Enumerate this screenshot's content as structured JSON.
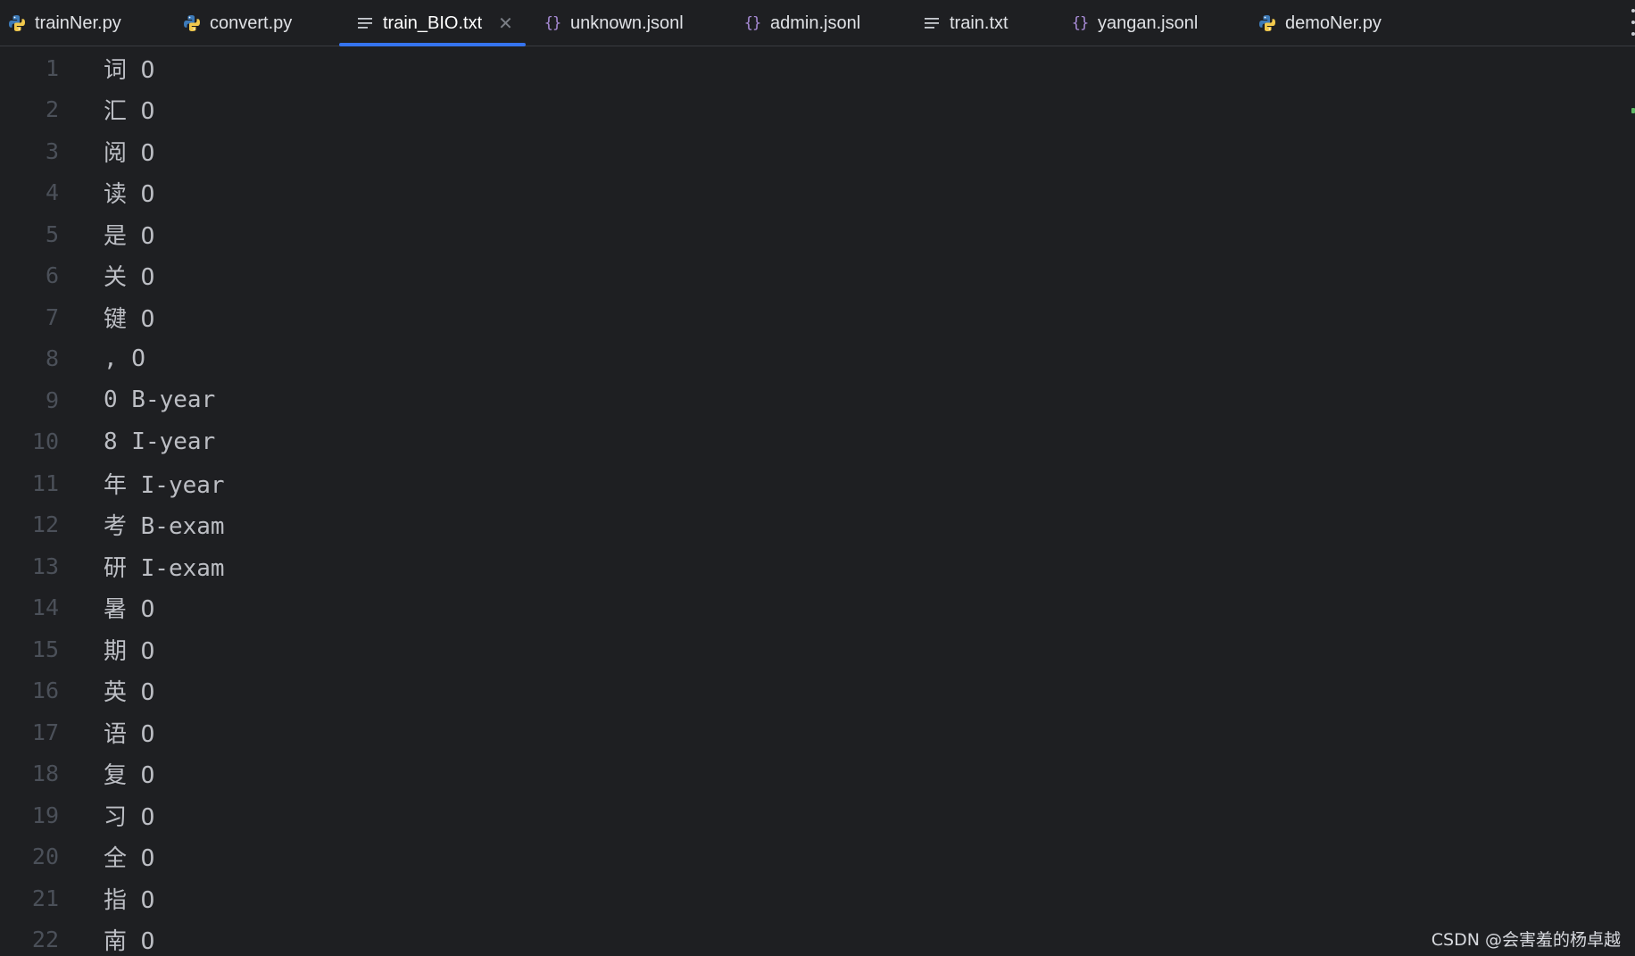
{
  "tabs": [
    {
      "label": "trainNer.py",
      "icon": "python-icon"
    },
    {
      "label": "convert.py",
      "icon": "python-icon"
    },
    {
      "label": "train_BIO.txt",
      "icon": "text-file-icon",
      "active": true
    },
    {
      "label": "unknown.jsonl",
      "icon": "json-icon"
    },
    {
      "label": "admin.jsonl",
      "icon": "json-icon"
    },
    {
      "label": "train.txt",
      "icon": "text-file-icon"
    },
    {
      "label": "yangan.jsonl",
      "icon": "json-icon"
    },
    {
      "label": "demoNer.py",
      "icon": "python-icon"
    }
  ],
  "editor": {
    "lines": [
      {
        "num": "1",
        "text": "词 O"
      },
      {
        "num": "2",
        "text": "汇 O"
      },
      {
        "num": "3",
        "text": "阅 O"
      },
      {
        "num": "4",
        "text": "读 O"
      },
      {
        "num": "5",
        "text": "是 O"
      },
      {
        "num": "6",
        "text": "关 O"
      },
      {
        "num": "7",
        "text": "键 O"
      },
      {
        "num": "8",
        "text": ", O"
      },
      {
        "num": "9",
        "text": "0 B-year"
      },
      {
        "num": "10",
        "text": "8 I-year"
      },
      {
        "num": "11",
        "text": "年 I-year"
      },
      {
        "num": "12",
        "text": "考 B-exam"
      },
      {
        "num": "13",
        "text": "研 I-exam"
      },
      {
        "num": "14",
        "text": "暑 O"
      },
      {
        "num": "15",
        "text": "期 O"
      },
      {
        "num": "16",
        "text": "英 O"
      },
      {
        "num": "17",
        "text": "语 O"
      },
      {
        "num": "18",
        "text": "复 O"
      },
      {
        "num": "19",
        "text": "习 O"
      },
      {
        "num": "20",
        "text": "全 O"
      },
      {
        "num": "21",
        "text": "指 O"
      },
      {
        "num": "22",
        "text": "南 O"
      }
    ]
  },
  "watermark": "CSDN @会害羞的杨卓越",
  "colors": {
    "background": "#1e1f22",
    "accent": "#3574f0",
    "line_number": "#4b5059",
    "code_text": "#bcbec4",
    "json_icon": "#a88bd6"
  }
}
